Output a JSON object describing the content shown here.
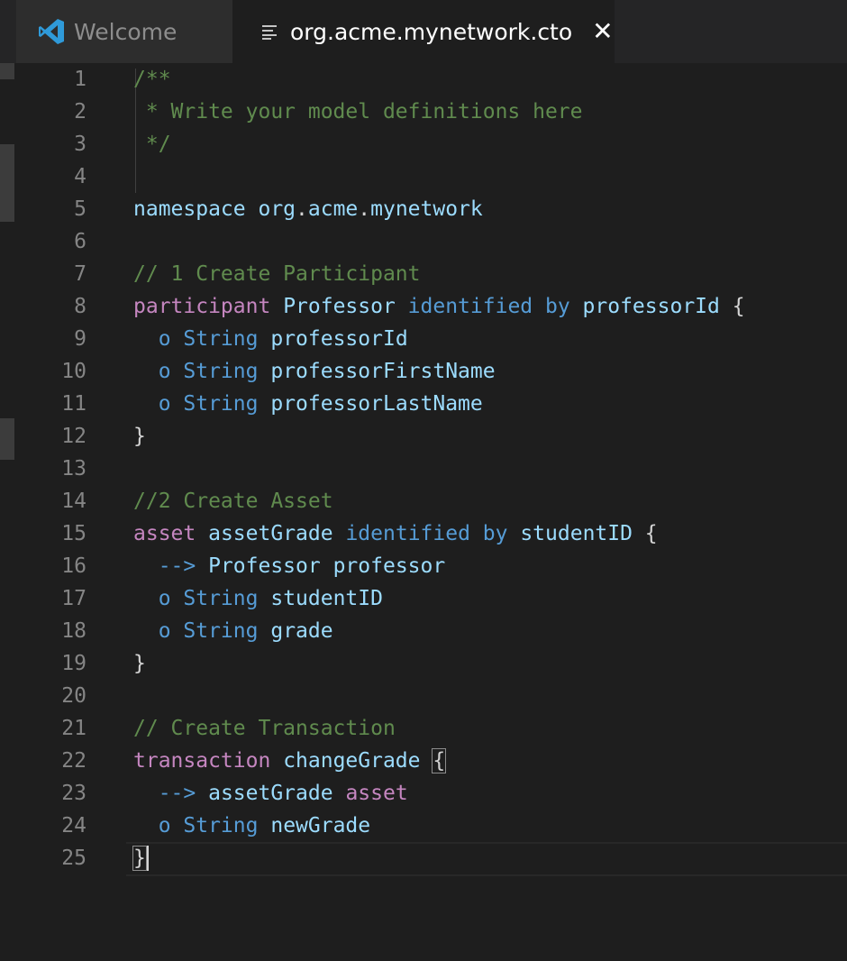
{
  "tabs": [
    {
      "label": "Welcome",
      "icon": "vscode-logo-icon",
      "active": false
    },
    {
      "label": "org.acme.mynetwork.cto",
      "icon": "file-lines-icon",
      "active": true,
      "close": "✕"
    }
  ],
  "colors": {
    "background": "#1e1e1e",
    "comment": "#608b4e",
    "keyword": "#c586c0",
    "modifier": "#569cd6",
    "type": "#4ec9b0",
    "identifier": "#9cdcfe",
    "line_number": "#858585"
  },
  "editor": {
    "lines": [
      {
        "n": "1",
        "tokens": [
          {
            "t": "/**",
            "c": "comment"
          }
        ]
      },
      {
        "n": "2",
        "tokens": [
          {
            "t": " * Write your model definitions here",
            "c": "comment"
          }
        ]
      },
      {
        "n": "3",
        "tokens": [
          {
            "t": " */",
            "c": "comment"
          }
        ]
      },
      {
        "n": "4",
        "tokens": []
      },
      {
        "n": "5",
        "tokens": [
          {
            "t": "namespace",
            "c": "id"
          },
          {
            "t": " ",
            "c": "plain"
          },
          {
            "t": "org",
            "c": "id"
          },
          {
            "t": ".",
            "c": "plain"
          },
          {
            "t": "acme",
            "c": "id"
          },
          {
            "t": ".",
            "c": "plain"
          },
          {
            "t": "mynetwork",
            "c": "id"
          }
        ]
      },
      {
        "n": "6",
        "tokens": []
      },
      {
        "n": "7",
        "tokens": [
          {
            "t": "// 1 Create Participant",
            "c": "comment"
          }
        ]
      },
      {
        "n": "8",
        "tokens": [
          {
            "t": "participant",
            "c": "kw"
          },
          {
            "t": " ",
            "c": "plain"
          },
          {
            "t": "Professor",
            "c": "id"
          },
          {
            "t": " ",
            "c": "plain"
          },
          {
            "t": "identified by",
            "c": "mod"
          },
          {
            "t": " ",
            "c": "plain"
          },
          {
            "t": "professorId",
            "c": "id"
          },
          {
            "t": " {",
            "c": "plain"
          }
        ]
      },
      {
        "n": "9",
        "tokens": [
          {
            "t": "  o ",
            "c": "mod"
          },
          {
            "t": "String",
            "c": "mod"
          },
          {
            "t": " ",
            "c": "plain"
          },
          {
            "t": "professorId",
            "c": "id"
          }
        ]
      },
      {
        "n": "10",
        "tokens": [
          {
            "t": "  o ",
            "c": "mod"
          },
          {
            "t": "String",
            "c": "mod"
          },
          {
            "t": " ",
            "c": "plain"
          },
          {
            "t": "professorFirstName",
            "c": "id"
          }
        ]
      },
      {
        "n": "11",
        "tokens": [
          {
            "t": "  o ",
            "c": "mod"
          },
          {
            "t": "String",
            "c": "mod"
          },
          {
            "t": " ",
            "c": "plain"
          },
          {
            "t": "professorLastName",
            "c": "id"
          }
        ]
      },
      {
        "n": "12",
        "tokens": [
          {
            "t": "}",
            "c": "plain"
          }
        ]
      },
      {
        "n": "13",
        "tokens": []
      },
      {
        "n": "14",
        "tokens": [
          {
            "t": "//2 Create Asset",
            "c": "comment"
          }
        ]
      },
      {
        "n": "15",
        "tokens": [
          {
            "t": "asset",
            "c": "kw"
          },
          {
            "t": " ",
            "c": "plain"
          },
          {
            "t": "assetGrade",
            "c": "id"
          },
          {
            "t": " ",
            "c": "plain"
          },
          {
            "t": "identified by",
            "c": "mod"
          },
          {
            "t": " ",
            "c": "plain"
          },
          {
            "t": "studentID",
            "c": "id"
          },
          {
            "t": " {",
            "c": "plain"
          }
        ]
      },
      {
        "n": "16",
        "tokens": [
          {
            "t": "  --> ",
            "c": "mod"
          },
          {
            "t": "Professor",
            "c": "id"
          },
          {
            "t": " ",
            "c": "plain"
          },
          {
            "t": "professor",
            "c": "id"
          }
        ]
      },
      {
        "n": "17",
        "tokens": [
          {
            "t": "  o ",
            "c": "mod"
          },
          {
            "t": "String",
            "c": "mod"
          },
          {
            "t": " ",
            "c": "plain"
          },
          {
            "t": "studentID",
            "c": "id"
          }
        ]
      },
      {
        "n": "18",
        "tokens": [
          {
            "t": "  o ",
            "c": "mod"
          },
          {
            "t": "String",
            "c": "mod"
          },
          {
            "t": " ",
            "c": "plain"
          },
          {
            "t": "grade",
            "c": "id"
          }
        ]
      },
      {
        "n": "19",
        "tokens": [
          {
            "t": "}",
            "c": "plain"
          }
        ]
      },
      {
        "n": "20",
        "tokens": []
      },
      {
        "n": "21",
        "tokens": [
          {
            "t": "// Create Transaction",
            "c": "comment"
          }
        ]
      },
      {
        "n": "22",
        "tokens": [
          {
            "t": "transaction",
            "c": "kw"
          },
          {
            "t": " ",
            "c": "plain"
          },
          {
            "t": "changeGrade",
            "c": "id"
          },
          {
            "t": " ",
            "c": "plain"
          },
          {
            "t": "{",
            "c": "plain",
            "box": true
          }
        ]
      },
      {
        "n": "23",
        "tokens": [
          {
            "t": "  --> ",
            "c": "mod"
          },
          {
            "t": "assetGrade",
            "c": "id"
          },
          {
            "t": " ",
            "c": "plain"
          },
          {
            "t": "asset",
            "c": "kw"
          }
        ]
      },
      {
        "n": "24",
        "tokens": [
          {
            "t": "  o ",
            "c": "mod"
          },
          {
            "t": "String",
            "c": "mod"
          },
          {
            "t": " ",
            "c": "plain"
          },
          {
            "t": "newGrade",
            "c": "id"
          }
        ]
      },
      {
        "n": "25",
        "tokens": [
          {
            "t": "}",
            "c": "plain",
            "box": true,
            "caret": true
          }
        ]
      }
    ]
  }
}
